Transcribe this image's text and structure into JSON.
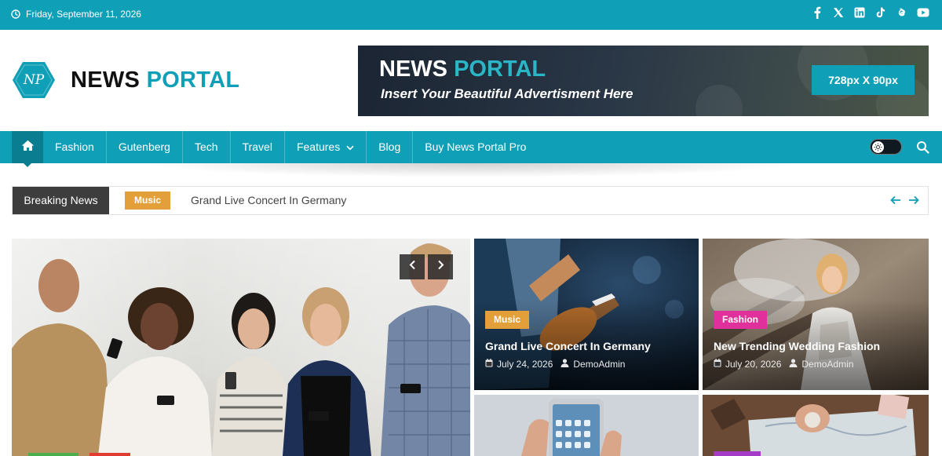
{
  "topbar": {
    "date": "Friday, September 11, 2026",
    "social_icons": [
      "facebook-icon",
      "x-twitter-icon",
      "linkedin-icon",
      "tiktok-icon",
      "threads-icon",
      "youtube-icon"
    ]
  },
  "logo": {
    "initials": "NP",
    "name_part1": "NEWS",
    "name_part2": "PORTAL"
  },
  "ad": {
    "title_part1": "NEWS",
    "title_part2": "PORTAL",
    "subtitle": "Insert Your Beautiful Advertisment Here",
    "size_label": "728px X 90px"
  },
  "nav": {
    "items": [
      {
        "label": "Fashion"
      },
      {
        "label": "Gutenberg"
      },
      {
        "label": "Tech"
      },
      {
        "label": "Travel"
      },
      {
        "label": "Features"
      },
      {
        "label": "Blog"
      },
      {
        "label": "Buy News Portal Pro"
      }
    ]
  },
  "breaking": {
    "label": "Breaking News",
    "category": "Music",
    "headline": "Grand Live Concert In Germany"
  },
  "cards": [
    {
      "category": "Music",
      "category_color": "#e3a03a",
      "title": "Grand Live Concert In Germany",
      "date": "July 24, 2026",
      "author": "DemoAdmin"
    },
    {
      "category": "Fashion",
      "category_color": "#e0309b",
      "title": "New Trending Wedding Fashion",
      "date": "July 20, 2026",
      "author": "DemoAdmin"
    }
  ],
  "colors": {
    "brand": "#0f9fb6",
    "brand_dark": "#0a7d90",
    "breaking_label": "#3d3d3d"
  }
}
